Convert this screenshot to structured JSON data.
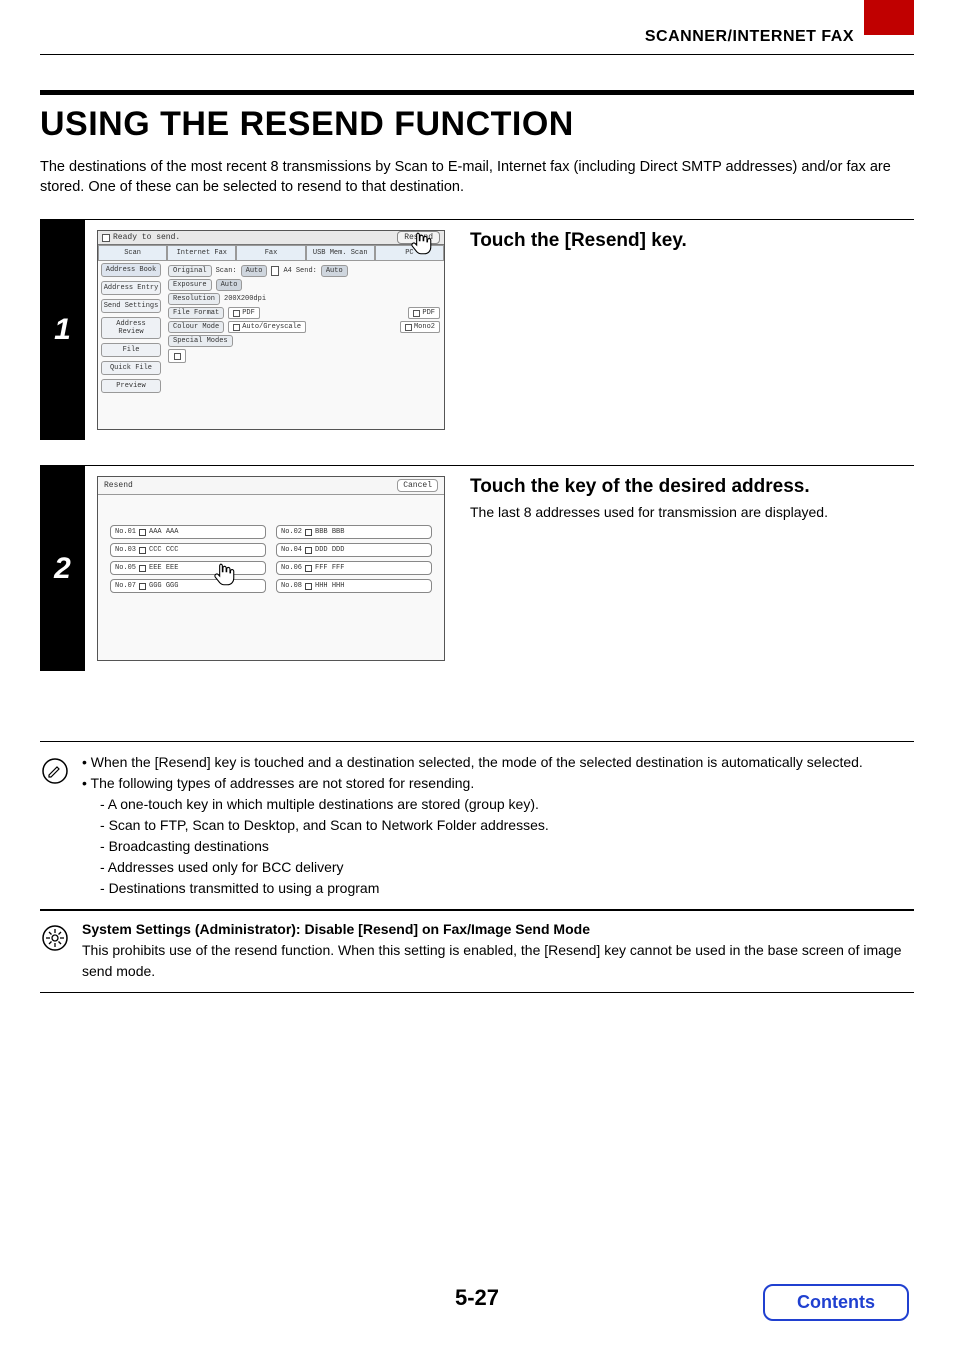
{
  "header": {
    "section": "SCANNER/INTERNET FAX"
  },
  "title": "USING THE RESEND FUNCTION",
  "intro": "The destinations of the most recent 8 transmissions by Scan to E-mail, Internet fax (including Direct SMTP addresses) and/or fax are stored. One of these can be selected to resend to that destination.",
  "steps": {
    "one": {
      "num": "1",
      "heading": "Touch the [Resend] key.",
      "panel": {
        "status": "Ready to send.",
        "resend": "Resend",
        "tabs": [
          "Scan",
          "Internet Fax",
          "Fax",
          "USB Mem. Scan",
          "PC"
        ],
        "side": [
          "Address Book",
          "Address Entry",
          "Send Settings",
          "Address Review",
          "File",
          "Quick File",
          "Preview"
        ],
        "rows": {
          "original": "Original",
          "scan": "Scan:",
          "auto1": "Auto",
          "a4": "A4",
          "send": "Send:",
          "auto2": "Auto",
          "exposure": "Exposure",
          "autoexp": "Auto",
          "resolution": "Resolution",
          "resval": "200X200dpi",
          "fileformat": "File Format",
          "pdf1": "PDF",
          "pdf2": "PDF",
          "colourmode": "Colour Mode",
          "autogrey": "Auto/Greyscale",
          "mono2": "Mono2",
          "special": "Special Modes"
        }
      }
    },
    "two": {
      "num": "2",
      "heading": "Touch the key of the desired address.",
      "sub": "The last 8 addresses used for transmission are displayed.",
      "panel": {
        "title": "Resend",
        "cancel": "Cancel",
        "entries": [
          {
            "n": "No.01",
            "t": "AAA AAA"
          },
          {
            "n": "No.02",
            "t": "BBB BBB"
          },
          {
            "n": "No.03",
            "t": "CCC CCC"
          },
          {
            "n": "No.04",
            "t": "DDD DDD"
          },
          {
            "n": "No.05",
            "t": "EEE EEE"
          },
          {
            "n": "No.06",
            "t": "FFF FFF"
          },
          {
            "n": "No.07",
            "t": "GGG GGG"
          },
          {
            "n": "No.08",
            "t": "HHH HHH"
          }
        ]
      }
    }
  },
  "note": {
    "b1": "When the [Resend] key is touched and a destination selected, the mode of the selected destination is automatically selected.",
    "b2": "The following types of addresses are not stored for resending.",
    "d1": "A one-touch key in which multiple destinations are stored (group key).",
    "d2": "Scan to FTP, Scan to Desktop, and Scan to Network Folder addresses.",
    "d3": "Broadcasting destinations",
    "d4": "Addresses used only for BCC delivery",
    "d5": "Destinations transmitted to using a program"
  },
  "settings": {
    "bold": "System Settings (Administrator): Disable [Resend] on Fax/Image Send Mode",
    "body": "This prohibits use of the resend function. When this setting is enabled, the [Resend] key cannot be used in the base screen of image send mode."
  },
  "pagenum": "5-27",
  "contents": "Contents"
}
